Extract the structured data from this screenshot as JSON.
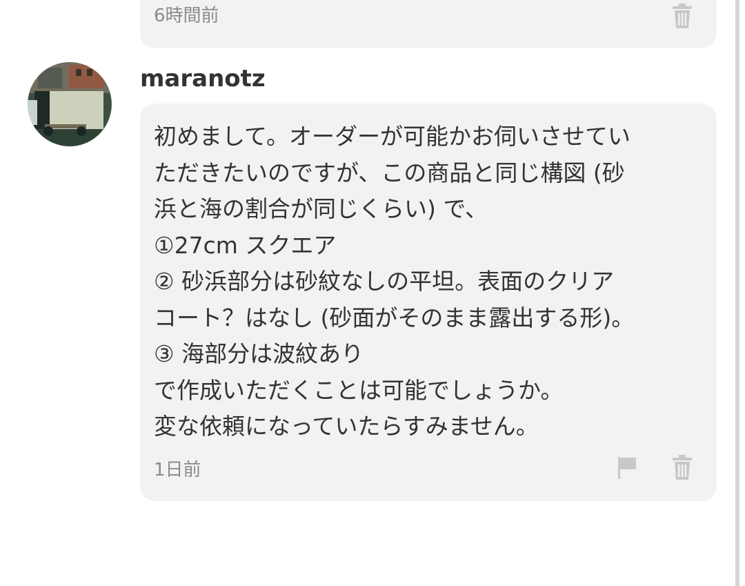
{
  "previous_comment": {
    "timestamp": "6時間前"
  },
  "comment": {
    "username": "maranotz",
    "message_lines": [
      "初めまして。オーダーが可能かお伺いさせてい",
      "ただきたいのですが、この商品と同じ構図 (砂",
      "浜と海の割合が同じくらい) で、",
      "①27cm スクエア",
      "② 砂浜部分は砂紋なしの平坦。表面のクリア",
      "コート？はなし (砂面がそのまま露出する形)。",
      "③ 海部分は波紋あり",
      "で作成いただくことは可能でしょうか。",
      "変な依頼になっていたらすみません。"
    ],
    "timestamp": "1日前"
  },
  "icons": {
    "trash": "trash-icon",
    "flag": "flag-icon"
  },
  "colors": {
    "bubble_background": "#f2f2f2",
    "text": "#333333",
    "muted_text": "#8a8a8a",
    "icon": "#c8c8c8"
  }
}
